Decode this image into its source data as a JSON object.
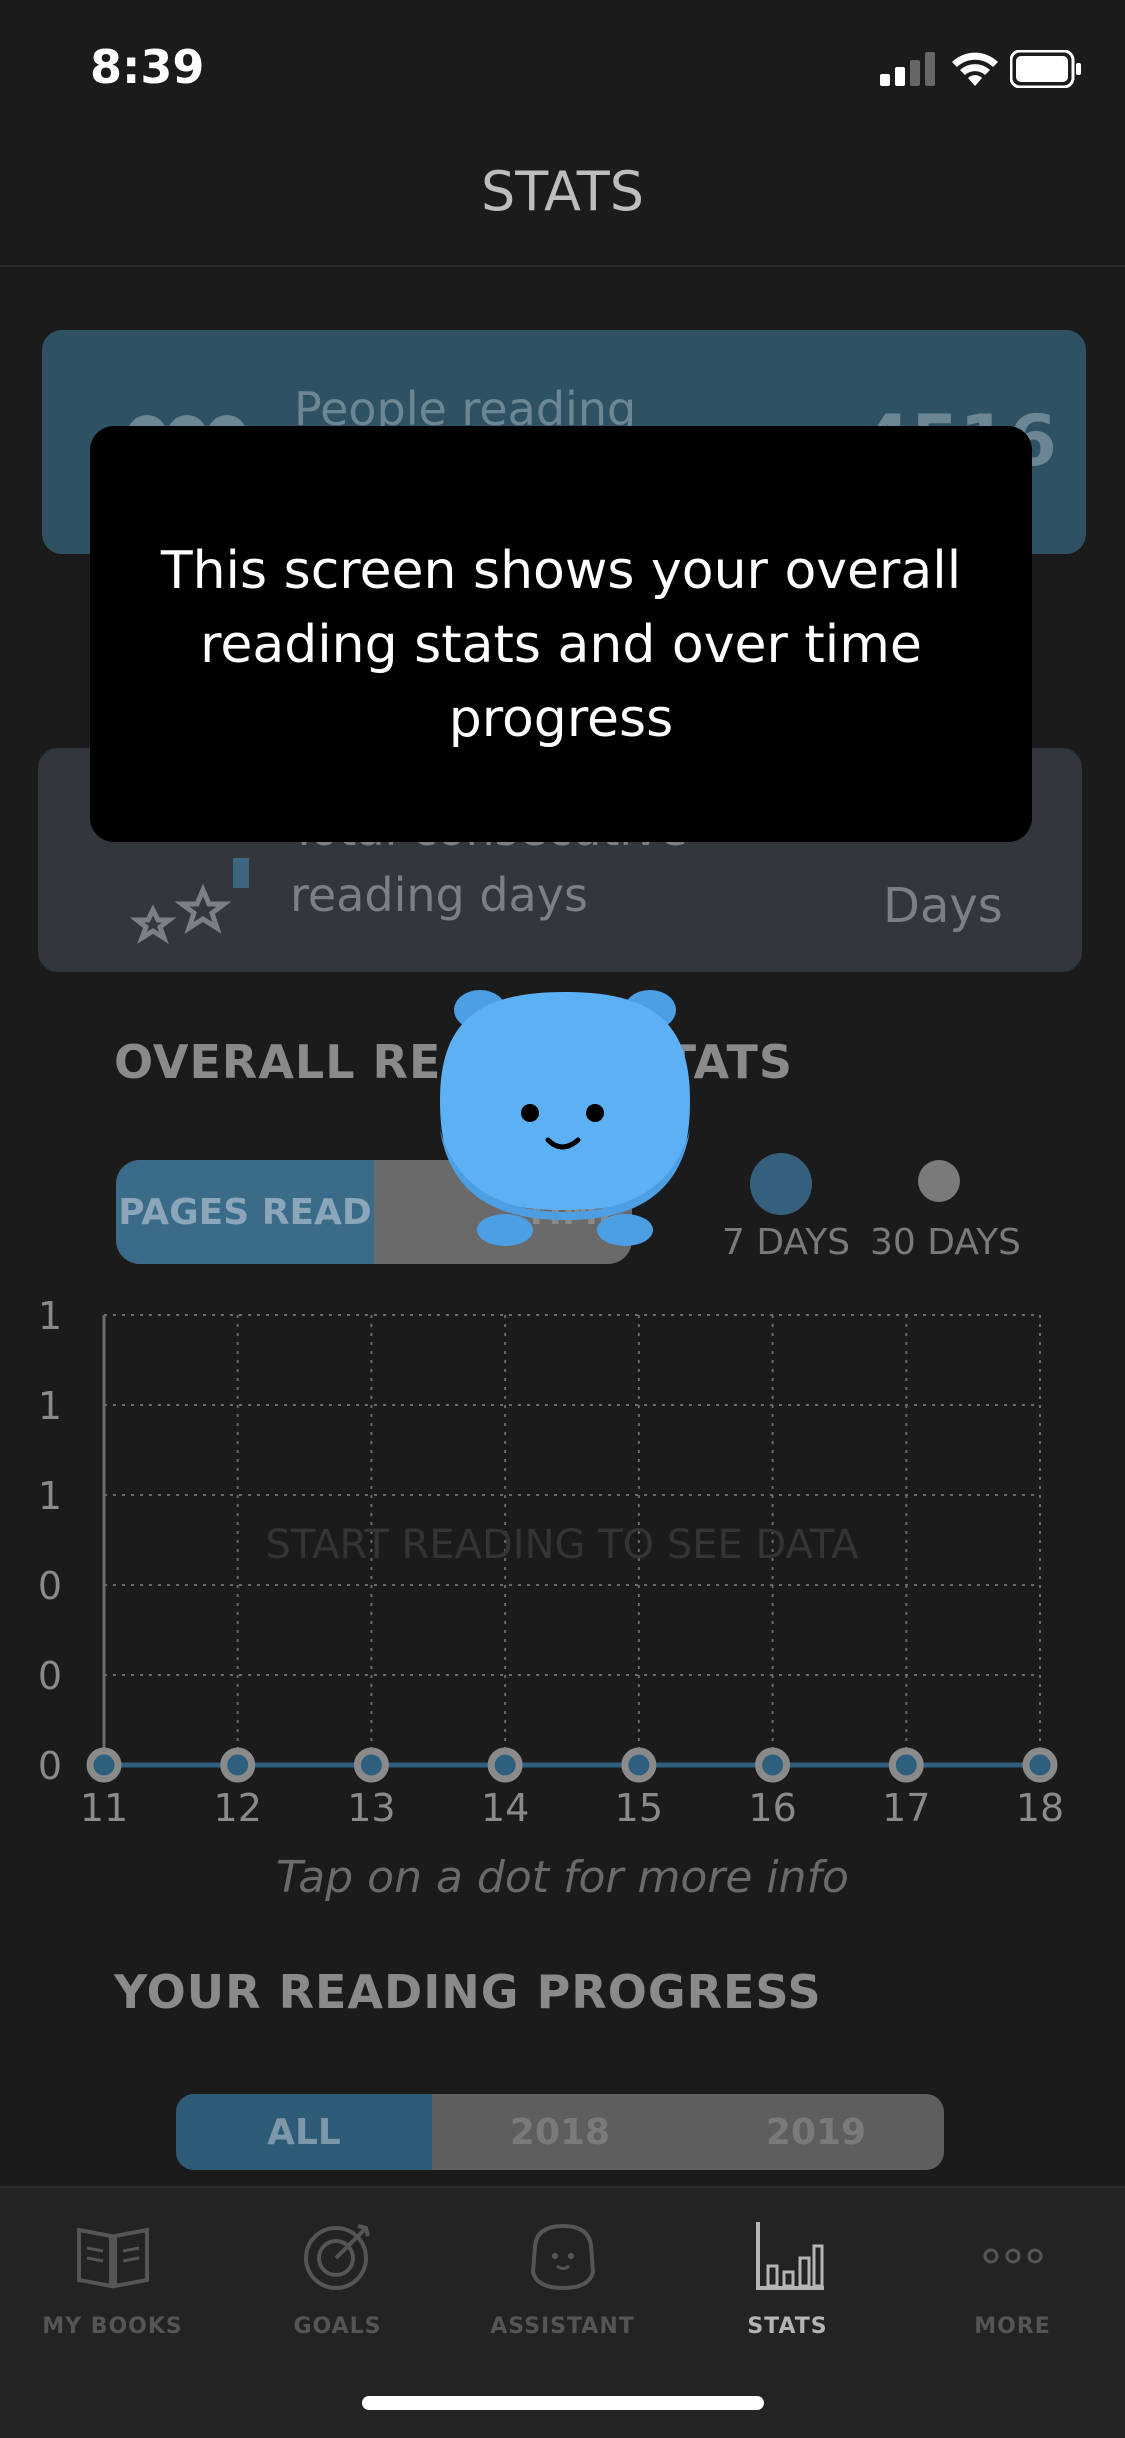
{
  "status_bar": {
    "time": "8:39"
  },
  "header": {
    "title": "STATS"
  },
  "cards": {
    "people": {
      "label": "People reading",
      "value": "4516"
    },
    "consecutive": {
      "label": "Total consecutive reading days",
      "unit": "Days"
    }
  },
  "tooltip": {
    "text": "This screen shows your overall reading stats and over time progress"
  },
  "overall": {
    "title": "OVERALL READING STATS",
    "metric_tabs": {
      "pages": "PAGES READ",
      "time": "TIME"
    },
    "range": {
      "seven": "7 DAYS",
      "thirty": "30 DAYS"
    }
  },
  "chart_data": {
    "type": "line",
    "categories": [
      "11",
      "12",
      "13",
      "14",
      "15",
      "16",
      "17",
      "18"
    ],
    "values": [
      0,
      0,
      0,
      0,
      0,
      0,
      0,
      0
    ],
    "ytick_labels": [
      "1",
      "1",
      "1",
      "0",
      "0",
      "0"
    ],
    "empty_message": "START READING TO SEE DATA",
    "grid": true,
    "colors": {
      "line": "#2f5f7e",
      "point_fill": "#2f5f7e",
      "point_ring": "#8a8a8a"
    }
  },
  "chart_hint": "Tap on a dot for more info",
  "progress": {
    "title": "YOUR READING PROGRESS",
    "tabs": [
      "ALL",
      "2018",
      "2019"
    ]
  },
  "tabbar": {
    "my_books": "MY BOOKS",
    "goals": "GOALS",
    "assistant": "ASSISTANT",
    "stats": "STATS",
    "more": "MORE"
  }
}
